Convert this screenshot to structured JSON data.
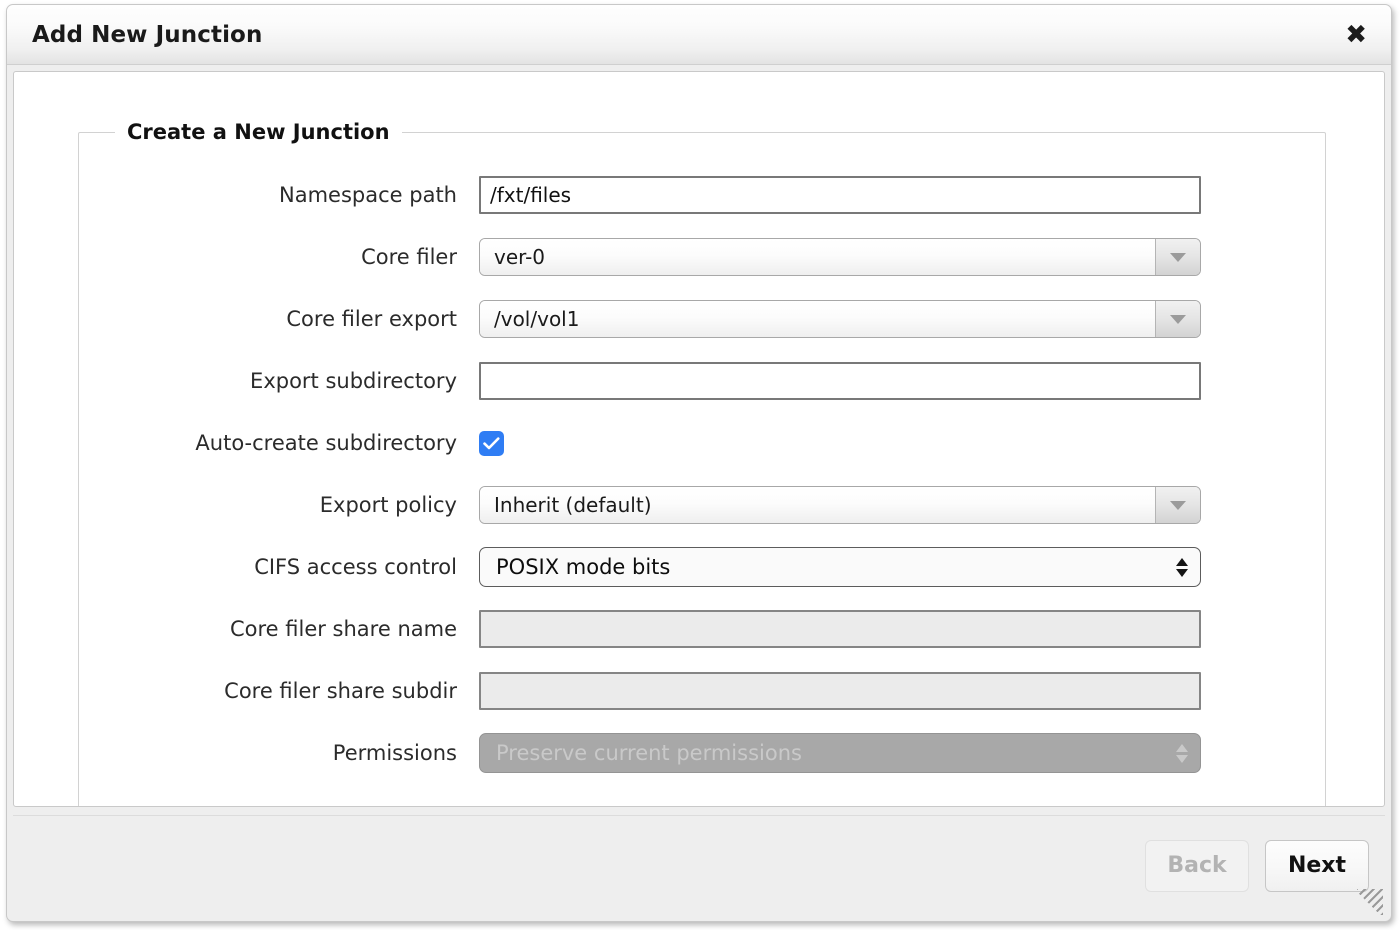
{
  "dialog": {
    "title": "Add New Junction",
    "close_icon": "close-icon"
  },
  "fieldset": {
    "legend": "Create a New Junction"
  },
  "fields": [
    {
      "label": "Namespace path",
      "type": "text",
      "value": "/fxt/files",
      "placeholder": "",
      "disabled": false
    },
    {
      "label": "Core filer",
      "type": "combo",
      "value": "ver-0",
      "disabled": false
    },
    {
      "label": "Core filer export",
      "type": "combo",
      "value": "/vol/vol1",
      "disabled": false
    },
    {
      "label": "Export subdirectory",
      "type": "text",
      "value": "",
      "placeholder": "",
      "disabled": false
    },
    {
      "label": "Auto-create subdirectory",
      "type": "checkbox",
      "checked": true,
      "disabled": false
    },
    {
      "label": "Export policy",
      "type": "combo",
      "value": "Inherit (default)",
      "disabled": false
    },
    {
      "label": "CIFS access control",
      "type": "select",
      "value": "POSIX mode bits",
      "disabled": false
    },
    {
      "label": "Core filer share name",
      "type": "text",
      "value": "",
      "placeholder": "",
      "disabled": true
    },
    {
      "label": "Core filer share subdir",
      "type": "text",
      "value": "",
      "placeholder": "",
      "disabled": true
    },
    {
      "label": "Permissions",
      "type": "select",
      "value": "Preserve current permissions",
      "disabled": true
    }
  ],
  "footer": {
    "back_label": "Back",
    "next_label": "Next",
    "back_disabled": true,
    "next_disabled": false,
    "resize_grip": "resize-grip-icon"
  },
  "colors": {
    "accent_checkbox": "#2f7df4",
    "titlebar_bg": "#f0f0f0",
    "footer_bg": "#eeeeee",
    "disabled_field_bg": "#ebebeb",
    "disabled_select_bg": "#a8a8a8"
  }
}
